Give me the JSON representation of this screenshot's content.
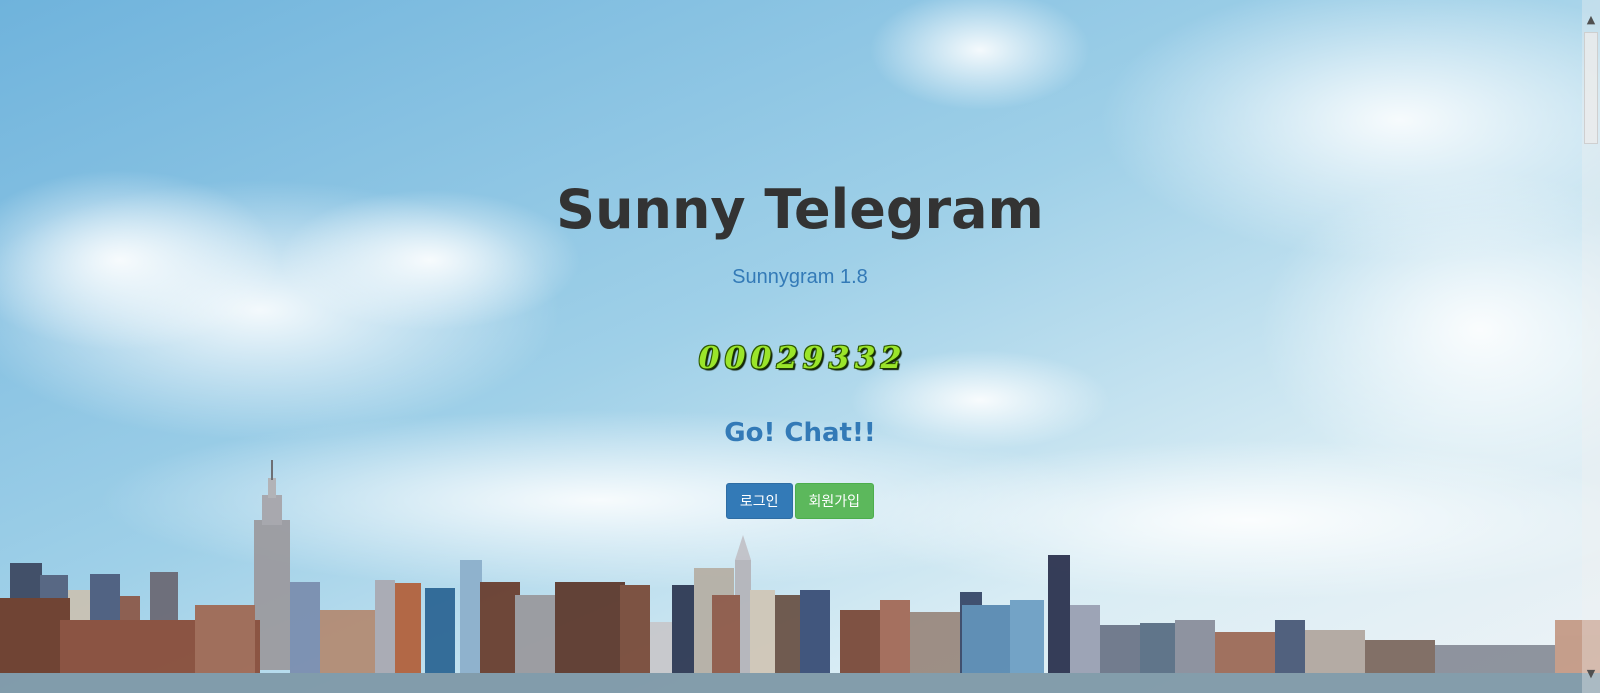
{
  "hero": {
    "title": "Sunny Telegram",
    "subtitle": "Sunnygram 1.8",
    "visitor_counter": [
      "0",
      "0",
      "0",
      "2",
      "9",
      "3",
      "3",
      "2"
    ],
    "tagline": "Go! Chat!!"
  },
  "buttons": {
    "login_label": "로그인",
    "signup_label": "회원가입"
  },
  "colors": {
    "title": "#333333",
    "accent_blue": "#337ab7",
    "success_green": "#5cb85c",
    "counter_digit": "#9be52a"
  },
  "background": {
    "description_icon": "city-skyline-photo"
  }
}
